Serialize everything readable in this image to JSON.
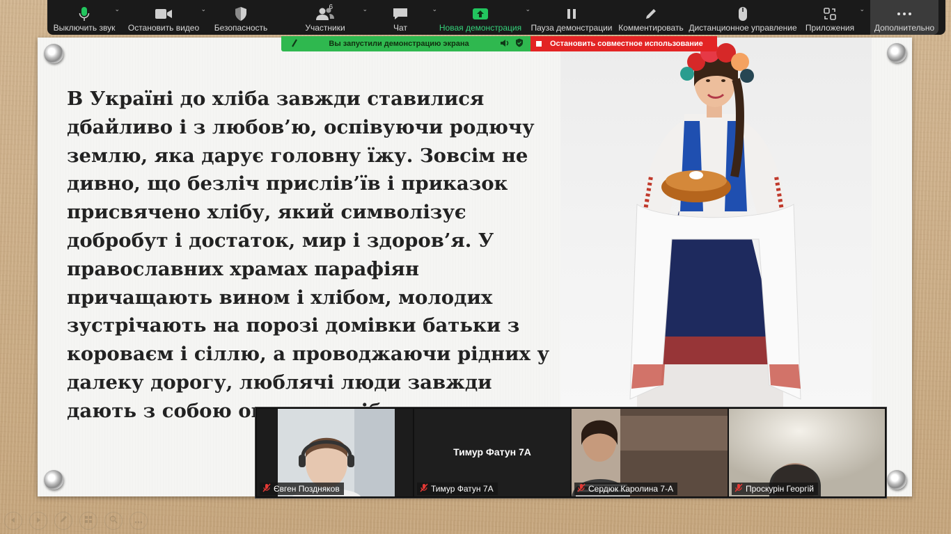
{
  "toolbar": {
    "mute": "Выключить звук",
    "stop_video": "Остановить видео",
    "security": "Безопасность",
    "participants": "Участники",
    "participants_count": "6",
    "chat": "Чат",
    "new_share": "Новая демонстрация",
    "pause_share": "Пауза демонстрации",
    "annotate": "Комментировать",
    "remote_control": "Дистанционное управление",
    "apps": "Приложения",
    "more": "Дополнительно"
  },
  "share_banner": {
    "status": "Вы запустили демонстрацию экрана",
    "stop": "Остановить совместное использование"
  },
  "slide": {
    "text": "В Україні до хліба завжди ставилися дбайливо і з любов’ю, оспівуючи родючу землю, яка дарує головну їжу. Зовсім не дивно, що безліч прислів’їв і приказок присвячено хлібу, який символізує добробут і достаток, мир і здоров’я. У православних храмах парафіян причащають вином і хлібом, молодих зустрічають на порозі домівки батьки з короваєм і сіллю, а проводжаючи рідних у далеку дорогу, люблячі люди завжди дають з собою окраєць хліба."
  },
  "participants": [
    {
      "name": "Євген Поздняков"
    },
    {
      "name": "Тимур Фатун 7А",
      "center_label": "Тимур Фатун 7А"
    },
    {
      "name": "Сердюк Каролина 7-А"
    },
    {
      "name": "Проскурін Георгій"
    }
  ],
  "colors": {
    "toolbar_bg": "#1a1a1a",
    "share_green": "#2fb84f",
    "share_red": "#e32424",
    "muted_red": "#e53935",
    "wood_bg": "#cdb08a"
  }
}
